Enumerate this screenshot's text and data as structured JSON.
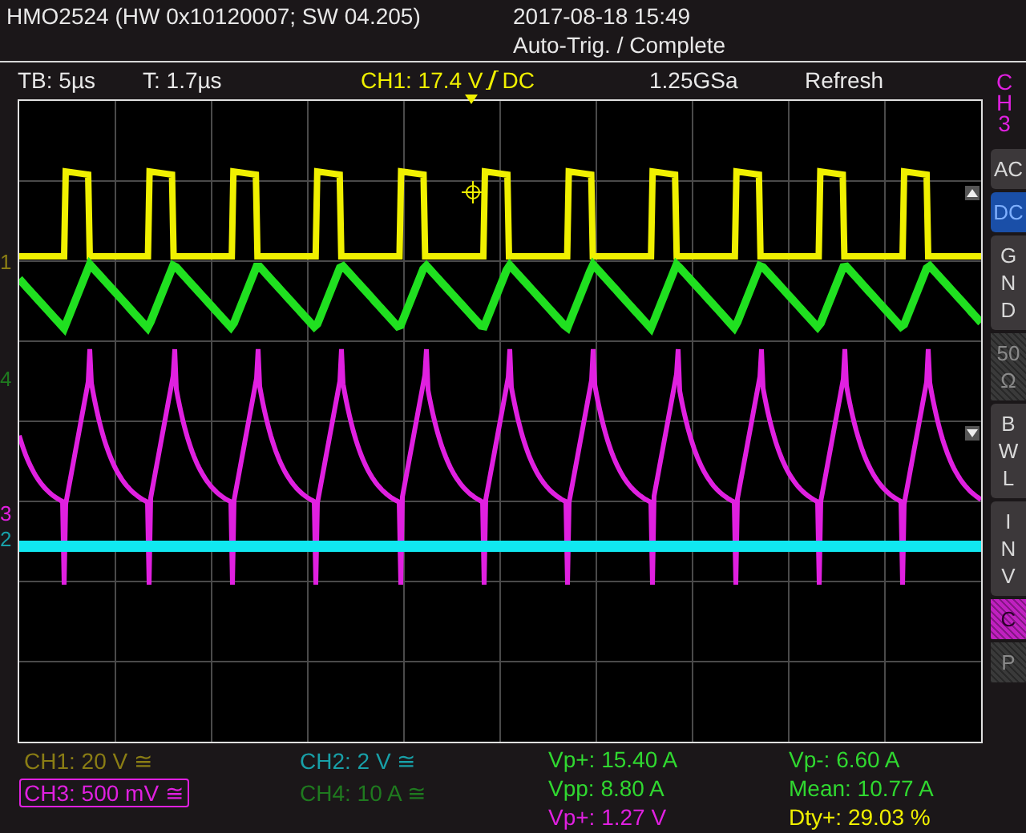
{
  "header": {
    "device": "HMO2524 (HW 0x10120007; SW 04.205)",
    "datetime": "2017-08-18 15:49",
    "status": "Auto-Trig. / Complete"
  },
  "settings": [
    {
      "kind": "info",
      "text": "TB: 5µs"
    },
    {
      "kind": "info",
      "text": "T: 1.7µs"
    },
    {
      "kind": "trigger",
      "source": "CH1: 17.4 V",
      "coupling": "DC"
    },
    {
      "kind": "info",
      "text": "1.25GSa"
    },
    {
      "kind": "info",
      "text": "Refresh"
    }
  ],
  "markers": [
    {
      "label": "1",
      "color": "#8a7d14"
    },
    {
      "label": "4",
      "color": "#1f7a1f"
    },
    {
      "label": "3",
      "color": "#e020e0"
    },
    {
      "label": "2",
      "color": "#18a0a8"
    }
  ],
  "side_panel": {
    "title": "C H 3",
    "buttons": [
      {
        "kind": "button",
        "label": "AC",
        "selected": false
      },
      {
        "kind": "button",
        "label": "DC",
        "selected": true
      },
      {
        "kind": "button",
        "label": "G N D",
        "selected": false
      },
      {
        "kind": "hatched",
        "label": "50 Ω",
        "color": "#3a3a3a"
      },
      {
        "kind": "button",
        "label": "B W L",
        "selected": false
      },
      {
        "kind": "button",
        "label": "I N V",
        "selected": false
      },
      {
        "kind": "hatched",
        "label": "C",
        "color": "#c020c0"
      },
      {
        "kind": "hatched",
        "label": "P",
        "color": "#3a3a3a"
      }
    ]
  },
  "channels": [
    {
      "label": "CH1: 20 V ≅",
      "color": "#8a7d14",
      "selected": false
    },
    {
      "label": "CH2: 2 V ≅",
      "color": "#18a0a8",
      "selected": false
    },
    {
      "label": "CH3: 500 mV ≅",
      "color": "#e020e0",
      "selected": true
    },
    {
      "label": "CH4: 10 A ≅",
      "color": "#1f7a1f",
      "selected": false
    }
  ],
  "measurements": [
    {
      "text": "Vp+: 15.40 A",
      "color": "#30d830"
    },
    {
      "text": "Vp-: 6.60 A",
      "color": "#30d830"
    },
    {
      "text": "Vpp: 8.80 A",
      "color": "#30d830"
    },
    {
      "text": "Mean: 10.77 A",
      "color": "#30d830"
    },
    {
      "text": "Vp+: 1.27 V",
      "color": "#e020e0"
    },
    {
      "text": "Dty+: 29.03 %",
      "color": "#f0f000"
    }
  ]
}
